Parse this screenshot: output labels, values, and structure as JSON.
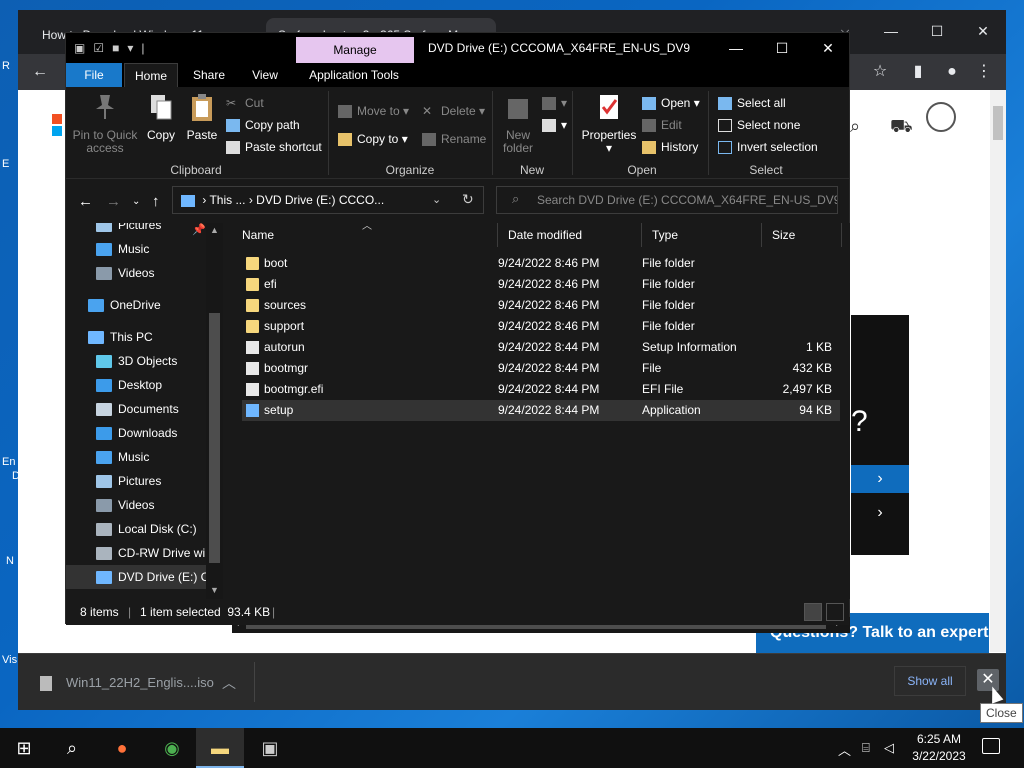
{
  "desktop": {
    "labels": [
      "R",
      "E",
      "En",
      "D",
      "N",
      "Vis"
    ]
  },
  "chrome": {
    "tab1": "How to Download Windows 11",
    "tab2": "Surface Laptop 3 - 365 Surface M...",
    "ctrl_min": "—",
    "ctrl_max": "☐",
    "ctrl_close": "✕",
    "promo_char": "?",
    "expert_button": "Questions? Talk to an expert",
    "download_file": "Win11_22H2_Englis....iso",
    "show_all": "Show all",
    "close_tooltip": "Close"
  },
  "explorer": {
    "manage_tab": "Manage",
    "title": "DVD Drive (E:) CCCOMA_X64FRE_EN-US_DV9",
    "tabs": {
      "file": "File",
      "home": "Home",
      "share": "Share",
      "view": "View",
      "app_tools": "Application Tools"
    },
    "ribbon": {
      "clipboard": {
        "pin": "Pin to Quick access",
        "copy": "Copy",
        "paste": "Paste",
        "cut": "Cut",
        "copy_path": "Copy path",
        "paste_shortcut": "Paste shortcut",
        "label": "Clipboard"
      },
      "organize": {
        "move_to": "Move to",
        "copy_to": "Copy to",
        "delete": "Delete",
        "rename": "Rename",
        "label": "Organize"
      },
      "new": {
        "new_folder": "New folder",
        "label": "New"
      },
      "open": {
        "properties": "Properties",
        "open": "Open",
        "edit": "Edit",
        "history": "History",
        "label": "Open"
      },
      "select": {
        "select_all": "Select all",
        "select_none": "Select none",
        "invert": "Invert selection",
        "label": "Select"
      }
    },
    "address": {
      "part1": "This ...",
      "part2": "DVD Drive (E:) CCCO...",
      "sep": "›"
    },
    "search_placeholder": "Search DVD Drive (E:) CCCOMA_X64FRE_EN-US_DV9",
    "nav": [
      {
        "label": "Pictures",
        "color": "#9fc6e8"
      },
      {
        "label": "Music",
        "color": "#4aa3ef"
      },
      {
        "label": "Videos",
        "color": "#8a9aaa"
      },
      {
        "label": "OneDrive",
        "color": "#4aa3ef"
      },
      {
        "label": "This PC",
        "color": "#6fb7ff"
      },
      {
        "label": "3D Objects",
        "color": "#5fc8ea"
      },
      {
        "label": "Desktop",
        "color": "#3c9bea"
      },
      {
        "label": "Documents",
        "color": "#c7d4e0"
      },
      {
        "label": "Downloads",
        "color": "#3c9bea"
      },
      {
        "label": "Music",
        "color": "#4aa3ef"
      },
      {
        "label": "Pictures",
        "color": "#9fc6e8"
      },
      {
        "label": "Videos",
        "color": "#8a9aaa"
      },
      {
        "label": "Local Disk (C:)",
        "color": "#aab4be"
      },
      {
        "label": "CD-RW Drive wi",
        "color": "#aab4be"
      },
      {
        "label": "DVD Drive (E:) C",
        "color": "#6fb7ff"
      }
    ],
    "columns": {
      "name": "Name",
      "date": "Date modified",
      "type": "Type",
      "size": "Size"
    },
    "files": [
      {
        "name": "boot",
        "date": "9/24/2022 8:46 PM",
        "type": "File folder",
        "size": "",
        "icon": "folder"
      },
      {
        "name": "efi",
        "date": "9/24/2022 8:46 PM",
        "type": "File folder",
        "size": "",
        "icon": "folder"
      },
      {
        "name": "sources",
        "date": "9/24/2022 8:46 PM",
        "type": "File folder",
        "size": "",
        "icon": "folder"
      },
      {
        "name": "support",
        "date": "9/24/2022 8:46 PM",
        "type": "File folder",
        "size": "",
        "icon": "folder"
      },
      {
        "name": "autorun",
        "date": "9/24/2022 8:44 PM",
        "type": "Setup Information",
        "size": "1 KB",
        "icon": "doc"
      },
      {
        "name": "bootmgr",
        "date": "9/24/2022 8:44 PM",
        "type": "File",
        "size": "432 KB",
        "icon": "doc"
      },
      {
        "name": "bootmgr.efi",
        "date": "9/24/2022 8:44 PM",
        "type": "EFI File",
        "size": "2,497 KB",
        "icon": "doc"
      },
      {
        "name": "setup",
        "date": "9/24/2022 8:44 PM",
        "type": "Application",
        "size": "94 KB",
        "icon": "app",
        "selected": true
      }
    ],
    "status": {
      "count": "8 items",
      "selection": "1 item selected  93.4 KB"
    }
  },
  "taskbar": {
    "time": "6:25 AM",
    "date": "3/22/2023"
  }
}
